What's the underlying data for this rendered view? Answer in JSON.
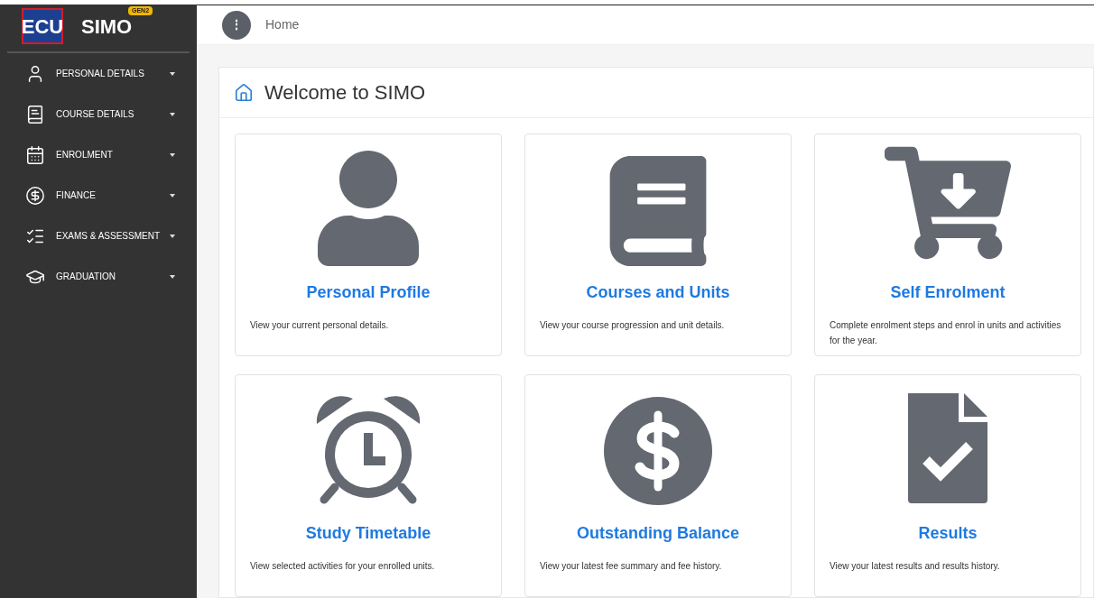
{
  "brand": {
    "logo": "ECU",
    "title": "SIMO",
    "badge": "GEN2"
  },
  "sidebar": {
    "items": [
      {
        "label": "PERSONAL DETAILS",
        "expanded": false
      },
      {
        "label": "COURSE DETAILS",
        "expanded": false
      },
      {
        "label": "ENROLMENT",
        "expanded": false
      },
      {
        "label": "FINANCE",
        "expanded": false
      },
      {
        "label": "EXAMS & ASSESSMENT",
        "expanded": false
      },
      {
        "label": "GRADUATION",
        "expanded": false
      }
    ]
  },
  "header": {
    "menu_glyph": "⋮",
    "breadcrumb": "Home"
  },
  "panel": {
    "title": "Welcome to SIMO"
  },
  "cards": [
    {
      "title": "Personal Profile",
      "description": "View your current personal details."
    },
    {
      "title": "Courses and Units",
      "description": "View your course progression and unit details."
    },
    {
      "title": "Self Enrolment",
      "description": "Complete enrolment steps and enrol in units and activities for the year."
    },
    {
      "title": "Study Timetable",
      "description": "View selected activities for your enrolled units."
    },
    {
      "title": "Outstanding Balance",
      "description": "View your latest fee summary and fee history."
    },
    {
      "title": "Results",
      "description": "View your latest results and results history."
    }
  ]
}
